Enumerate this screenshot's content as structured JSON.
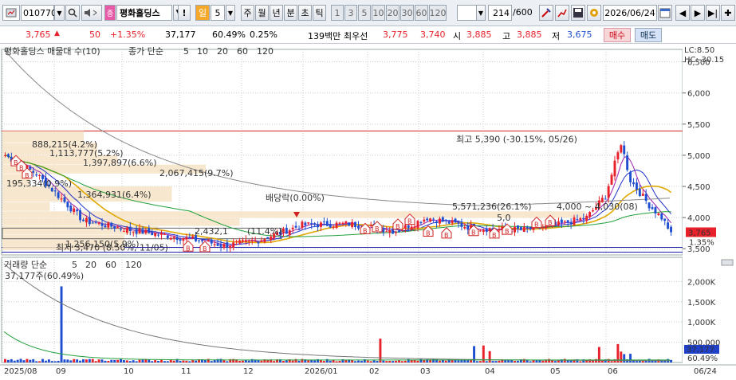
{
  "toolbar": {
    "code": "010770",
    "stock_name": "평화홀딩스",
    "excl": "!",
    "period_day": "일",
    "period_num": "5",
    "tabs": [
      "주",
      "월",
      "년",
      "분",
      "초",
      "틱"
    ],
    "nums": [
      "1",
      "3",
      "5",
      "10",
      "20",
      "30",
      "60",
      "120"
    ],
    "count": "214",
    "count_total": "/600",
    "date": "2026/06/24"
  },
  "info": {
    "price": "3,765",
    "change": "50",
    "pct": "+1.35%",
    "volume": "37,177",
    "vol_pct": "60.49%",
    "turnover": "0.25%",
    "amount": "139백만",
    "best_label": "최우선",
    "ask": "3,775",
    "bid": "3,740",
    "open_label": "시",
    "open": "3,885",
    "high_label": "고",
    "high": "3,885",
    "low_label": "저",
    "low": "3,675",
    "buy": "매수",
    "sell": "매도"
  },
  "price_panel": {
    "title": "평화홀딩스 매물대 수(10)",
    "ma_label": "종가 단순",
    "ma_periods": [
      "5",
      "10",
      "20",
      "60",
      "120"
    ],
    "ma_colors": [
      "#9b1fb0",
      "#2233cc",
      "#e0a800",
      "#22a03c",
      "#888888"
    ],
    "lc": "LC:8.50",
    "hc": "HC:-30.15",
    "y_ticks": [
      "6,500",
      "6,000",
      "5,500",
      "5,000",
      "4,500",
      "4,000",
      "3,500"
    ],
    "cur_price": "3,765",
    "cur_pct": "1.35%",
    "high_ann": "최고 5,390 (-30.15%, 05/26)",
    "low_ann": "최저 3,470 (8.50%, 11/05)",
    "div_ann": "배당락(0.00%)",
    "profile": [
      "888,215(4.2%)",
      "1,113,777(5.2%)",
      "1,397,897(6.6%)",
      "2,067,415(9.7%)",
      "195,334(0.9%)",
      "1,364,931(6.4%)",
      "5,571,236(26.1%)",
      "5,0",
      "2,432,1",
      "(11.4%)",
      "1,256,150(5.9%)"
    ],
    "range_ann": "4,000 ~ 4,030(08)"
  },
  "volume_panel": {
    "title": "거래량 단순",
    "ma_periods": [
      "5",
      "20",
      "60",
      "120"
    ],
    "cur_label": "37,177주(60.49%)",
    "y_ticks": [
      "2,000K",
      "1,500K",
      "1,000K",
      "500,000"
    ],
    "cur_val": "37,177",
    "cur_pct": "60.49%"
  },
  "x_ticks": [
    "2025/08",
    "09",
    "10",
    "11",
    "12",
    "2026/01",
    "02",
    "03",
    "04",
    "05",
    "06",
    "06/24"
  ],
  "colors": {
    "up": "#e8212b",
    "down": "#1f4fd0",
    "bg": "#ffffff",
    "grid": "#cccccc"
  },
  "chart_data": {
    "type": "candlestick",
    "y_range": [
      3400,
      6700
    ],
    "high": 5390,
    "low": 3470,
    "last_close": 3765,
    "volume_last": 37177
  }
}
